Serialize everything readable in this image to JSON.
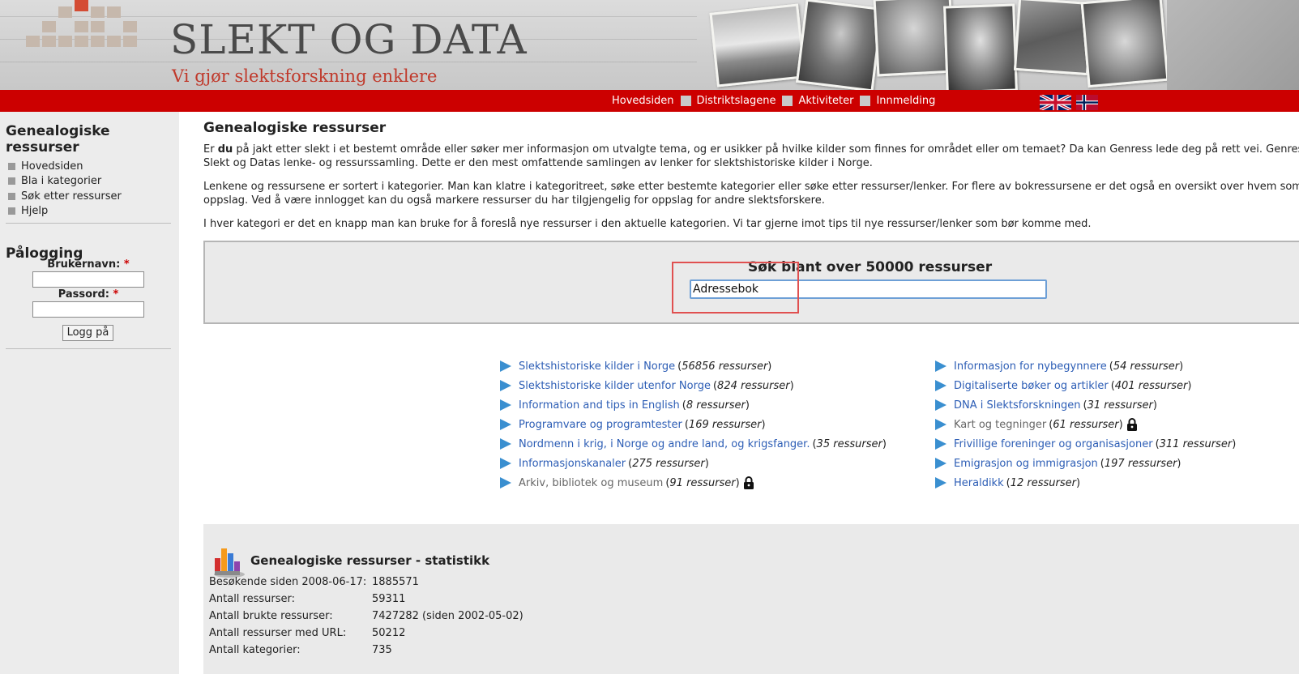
{
  "header": {
    "site_title": "SLEKT OG DATA",
    "tagline": "Vi gjør slektsforskning enklere"
  },
  "nav": {
    "items": [
      "Hovedsiden",
      "Distriktslagene",
      "Aktiviteter",
      "Innmelding"
    ],
    "flags": [
      "uk-flag-icon",
      "norway-flag-icon"
    ]
  },
  "sidebar": {
    "resources_heading": "Genealogiske ressurser",
    "menu": [
      "Hovedsiden",
      "Bla i kategorier",
      "Søk etter ressurser",
      "Hjelp"
    ],
    "login_heading": "Pålogging",
    "username_label": "Brukernavn:",
    "password_label": "Passord:",
    "required_marker": "*",
    "login_button": "Logg på"
  },
  "main": {
    "title": "Genealogiske ressurser",
    "intro_1a": "Er ",
    "intro_1b": "du",
    "intro_1c": " på jakt etter slekt i et bestemt område eller søker mer informasjon om utvalgte tema, og er usikker på hvilke kilder som finnes for området eller om temaet? Da kan Genress lede deg på rett vei. Genress",
    "intro_2": "Slekt og Datas lenke- og ressurssamling. Dette er den mest omfattende samlingen av lenker for slektshistoriske kilder i Norge.",
    "para_2a": "Lenkene og ressursene er sortert i kategorier. Man kan klatre i kategoritreet, søke etter bestemte kategorier eller søke etter ressurser/lenker. For flere av bokressursene er det også en oversikt over hvem som",
    "para_2b": "oppslag. Ved å være innlogget kan du også markere ressurser du har tilgjengelig for oppslag for andre slektsforskere.",
    "para_3": "I hver kategori er det en knapp man kan bruke for å foreslå nye ressurser i den aktuelle kategorien. Vi tar gjerne imot tips til nye ressurser/lenker som bør komme med."
  },
  "search": {
    "heading": "Søk blant over 50000 ressurser",
    "value": "Adressebok"
  },
  "categories": {
    "left": [
      {
        "label": "Slektshistoriske kilder i Norge",
        "count": "56856 ressurser",
        "locked": false
      },
      {
        "label": "Slektshistoriske kilder utenfor Norge",
        "count": "824 ressurser",
        "locked": false
      },
      {
        "label": "Information and tips in English",
        "count": "8 ressurser",
        "locked": false
      },
      {
        "label": "Programvare og programtester",
        "count": "169 ressurser",
        "locked": false
      },
      {
        "label": "Nordmenn i krig, i Norge og andre land, og krigsfanger.",
        "count": "35 ressurser",
        "locked": false
      },
      {
        "label": "Informasjonskanaler",
        "count": "275 ressurser",
        "locked": false
      },
      {
        "label": "Arkiv, bibliotek og museum",
        "count": "91 ressurser",
        "locked": true
      }
    ],
    "right": [
      {
        "label": "Informasjon for nybegynnere",
        "count": "54 ressurser",
        "locked": false
      },
      {
        "label": "Digitaliserte bøker og artikler",
        "count": "401 ressurser",
        "locked": false
      },
      {
        "label": "DNA i Slektsforskningen",
        "count": "31 ressurser",
        "locked": false
      },
      {
        "label": "Kart og tegninger",
        "count": "61 ressurser",
        "locked": true
      },
      {
        "label": "Frivillige foreninger og organisasjoner",
        "count": "311 ressurser",
        "locked": false
      },
      {
        "label": "Emigrasjon og immigrasjon",
        "count": "197 ressurser",
        "locked": false
      },
      {
        "label": "Heraldikk",
        "count": "12 ressurser",
        "locked": false
      }
    ]
  },
  "stats": {
    "title": "Genealogiske ressurser - statistikk",
    "rows": [
      {
        "label": "Besøkende siden 2008-06-17:",
        "value": "1885571"
      },
      {
        "label": "Antall ressurser:",
        "value": "59311"
      },
      {
        "label": "Antall brukte ressurser:",
        "value": "7427282 (siden 2002-05-02)"
      },
      {
        "label": "Antall ressurser med URL:",
        "value": "50212"
      },
      {
        "label": "Antall kategorier:",
        "value": "735"
      }
    ]
  },
  "colors": {
    "nav_red": "#cc0000",
    "link_blue": "#2c5db5",
    "arrow_blue": "#3a8fd0",
    "tagline_red": "#c0392b",
    "highlight_red": "#e05050"
  }
}
